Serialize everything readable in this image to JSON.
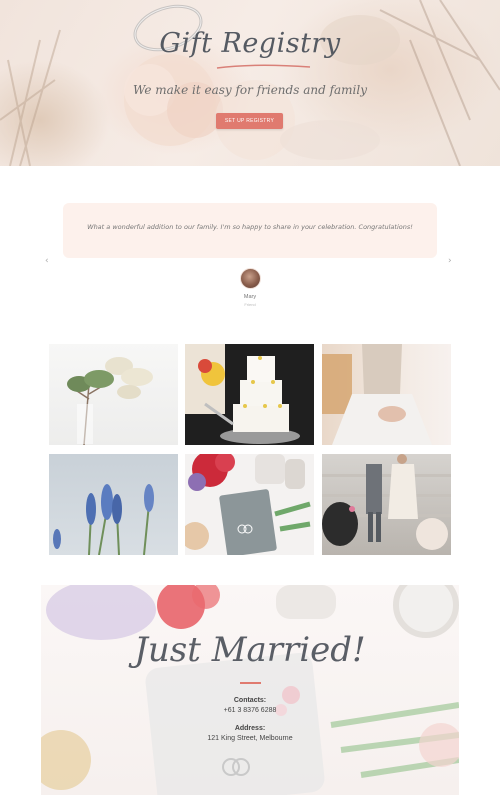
{
  "hero": {
    "title": "Gift Registry",
    "subtitle": "We make it easy for friends and family",
    "button_label": "SET UP REGISTRY"
  },
  "testimonial": {
    "quote": "What a wonderful addition to our family. I'm so happy to share in your celebration. Congratulations!",
    "author_name": "Mary",
    "author_role": "Friend",
    "prev_arrow": "‹",
    "next_arrow": "›"
  },
  "gallery": {
    "images": [
      {
        "subject": "white flower branch in vase"
      },
      {
        "subject": "wedding cake being cut"
      },
      {
        "subject": "bride in lace dress"
      },
      {
        "subject": "blue grape hyacinth flowers"
      },
      {
        "subject": "wedding invitation with rings and roses"
      },
      {
        "subject": "couple walking down steps"
      }
    ]
  },
  "just_married": {
    "title": "Just Married!",
    "contacts_label": "Contacts:",
    "phone": "+61 3 8376 6288",
    "address_label": "Address:",
    "address": "121 King Street, Melbourne"
  },
  "colors": {
    "accent": "#e07a6f",
    "quote_background": "#fdf1ec",
    "title_text": "#555a62"
  }
}
